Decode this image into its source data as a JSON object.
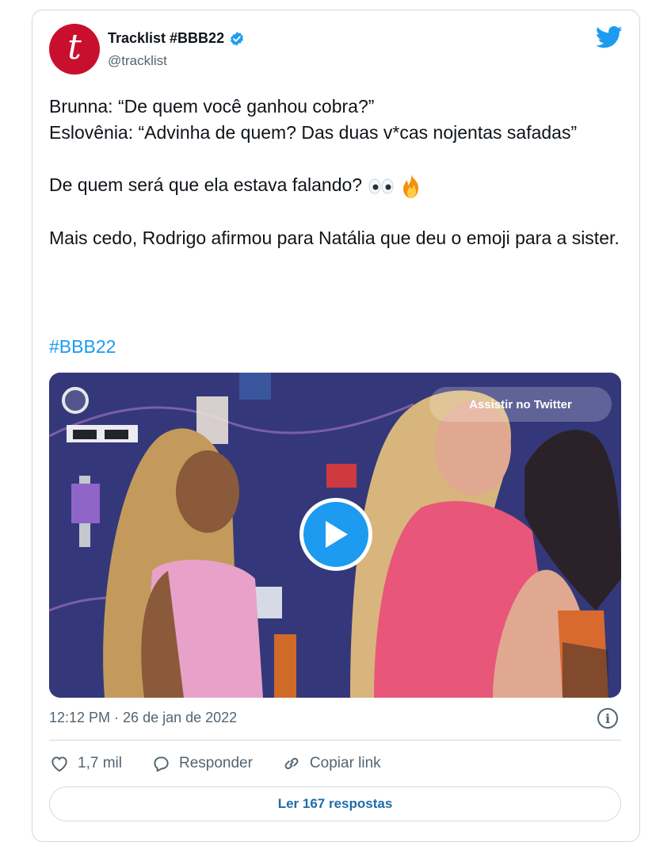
{
  "tweet": {
    "author_name": "Tracklist #BBB22",
    "author_handle": "@tracklist",
    "avatar_letter": "t",
    "line1": "Brunna: “De quem você ganhou cobra?”",
    "line2": "Eslovênia: “Advinha de quem? Das duas v*cas nojentas safadas”",
    "line3": "De quem será que ela estava falando?",
    "line3_emojis": [
      "eyes-emoji",
      "fire-emoji"
    ],
    "line4": "Mais cedo, Rodrigo afirmou para Natália que deu o emoji para a sister.",
    "hashtag": "#BBB22"
  },
  "media": {
    "watch_label": "Assistir no Twitter",
    "icons": [
      "live-indicator-icon",
      "play-icon"
    ]
  },
  "footer": {
    "timestamp": "12:12 PM · 26 de jan de 2022",
    "likes": "1,7 mil",
    "reply_label": "Responder",
    "copy_label": "Copiar link",
    "read_replies": "Ler 167 respostas"
  },
  "colors": {
    "accent": "#1d9bf0",
    "avatar": "#c8102e",
    "muted": "#536471"
  }
}
